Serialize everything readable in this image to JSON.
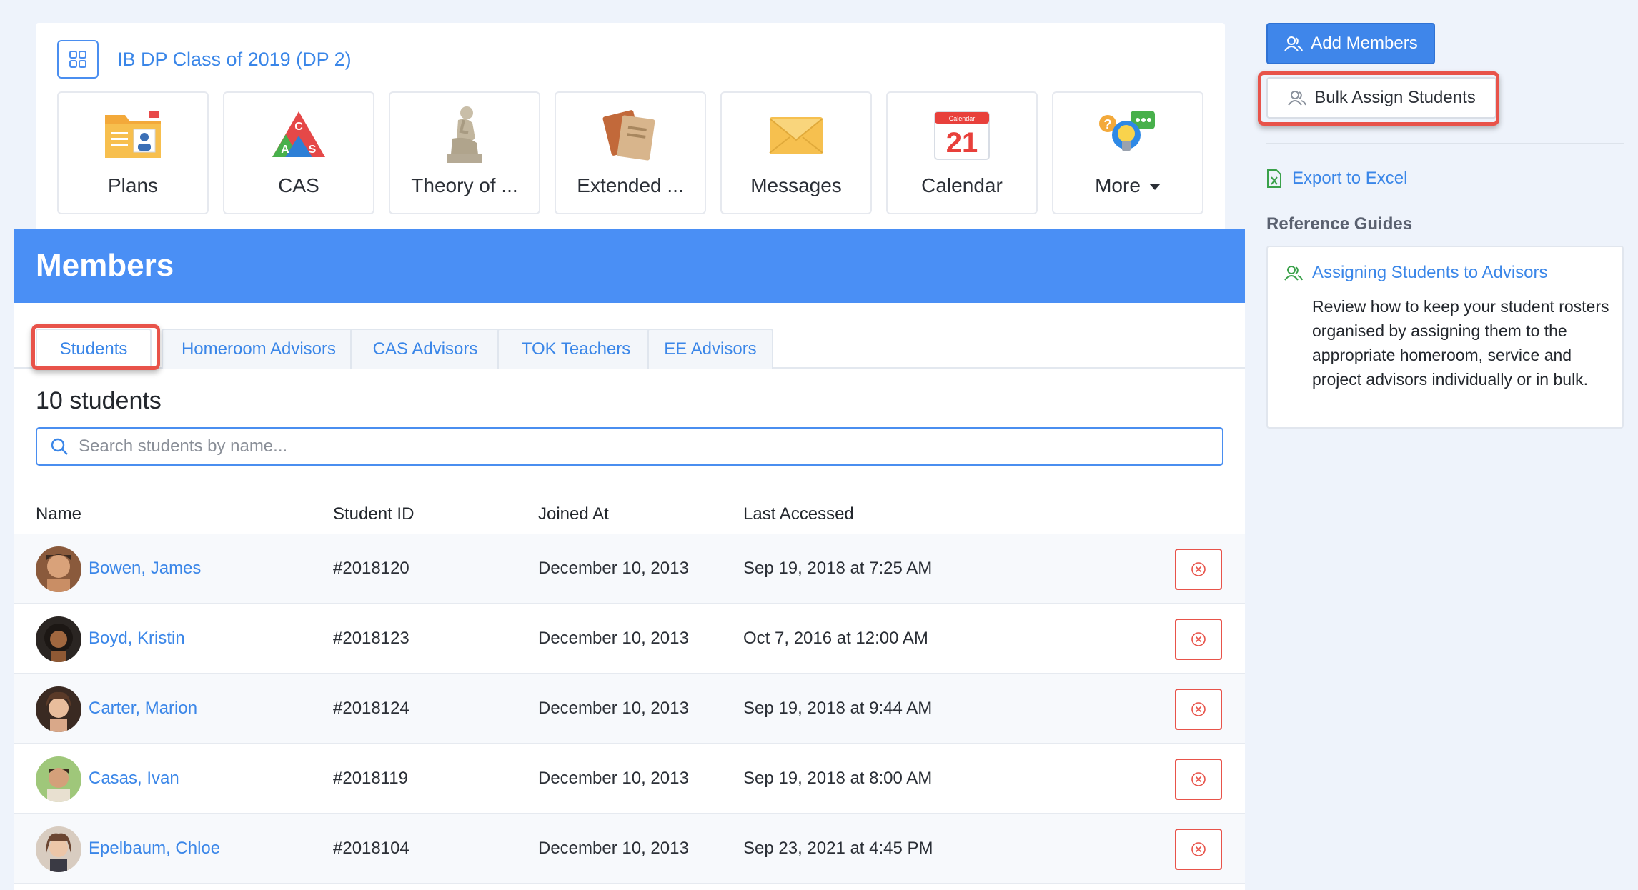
{
  "class_card": {
    "title": "IB DP Class of 2019 (DP 2)",
    "tiles": [
      {
        "label": "Plans",
        "icon": "folder-plans-icon"
      },
      {
        "label": "CAS",
        "icon": "cas-triangle-icon"
      },
      {
        "label": "Theory of ...",
        "icon": "thinker-statue-icon"
      },
      {
        "label": "Extended ...",
        "icon": "books-icon"
      },
      {
        "label": "Messages",
        "icon": "envelope-icon"
      },
      {
        "label": "Calendar",
        "icon": "calendar-icon",
        "day": "21",
        "banner": "Calendar"
      },
      {
        "label": "More",
        "icon": "lightbulb-chat-icon"
      }
    ]
  },
  "members": {
    "title": "Members",
    "tabs": [
      "Students",
      "Homeroom Advisors",
      "CAS Advisors",
      "TOK Teachers",
      "EE Advisors"
    ],
    "active_tab": "Students",
    "count_label": "10 students",
    "search_placeholder": "Search students by name...",
    "columns": [
      "Name",
      "Student ID",
      "Joined At",
      "Last Accessed"
    ],
    "rows": [
      {
        "name": "Bowen, James",
        "id": "#2018120",
        "joined": "December 10, 2013",
        "last": "Sep 19, 2018 at 7:25 AM"
      },
      {
        "name": "Boyd, Kristin",
        "id": "#2018123",
        "joined": "December 10, 2013",
        "last": "Oct 7, 2016 at 12:00 AM"
      },
      {
        "name": "Carter, Marion",
        "id": "#2018124",
        "joined": "December 10, 2013",
        "last": "Sep 19, 2018 at 9:44 AM"
      },
      {
        "name": "Casas, Ivan",
        "id": "#2018119",
        "joined": "December 10, 2013",
        "last": "Sep 19, 2018 at 8:00 AM"
      },
      {
        "name": "Epelbaum, Chloe",
        "id": "#2018104",
        "joined": "December 10, 2013",
        "last": "Sep 23, 2021 at 4:45 PM"
      }
    ]
  },
  "sidebar": {
    "add_members": "Add Members",
    "bulk_assign": "Bulk Assign Students",
    "export": "Export to Excel",
    "reference_title": "Reference Guides",
    "guide_link": "Assigning Students to Advisors",
    "guide_desc": "Review how to keep your student rosters organised by assigning them to the appropriate homeroom, service and project advisors individually or in bulk."
  },
  "colors": {
    "accent": "#3a86e8",
    "header_blue": "#4a8ff5",
    "highlight_red": "#e8534a",
    "background": "#eef3fb"
  }
}
